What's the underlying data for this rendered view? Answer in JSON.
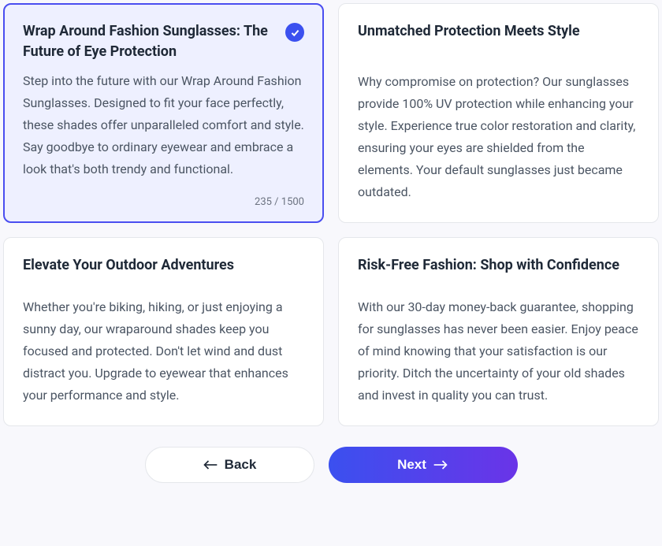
{
  "cards": {
    "c0": {
      "title": "Wrap Around Fashion Sunglasses: The Future of Eye Protection",
      "desc": "Step into the future with our Wrap Around Fashion Sunglasses. Designed to fit your face perfectly, these shades offer unparalleled comfort and style. Say goodbye to ordinary eyewear and embrace a look that's both trendy and functional.",
      "count": "235 / 1500"
    },
    "c1": {
      "title": "Unmatched Protection Meets Style",
      "desc": "Why compromise on protection? Our sunglasses provide 100% UV protection while enhancing your style. Experience true color restoration and clarity, ensuring your eyes are shielded from the elements. Your default sunglasses just became outdated."
    },
    "c2": {
      "title": "Elevate Your Outdoor Adventures",
      "desc": "Whether you're biking, hiking, or just enjoying a sunny day, our wraparound shades keep you focused and protected. Don't let wind and dust distract you. Upgrade to eyewear that enhances your performance and style."
    },
    "c3": {
      "title": "Risk-Free Fashion: Shop with Confidence",
      "desc": "With our 30-day money-back guarantee, shopping for sunglasses has never been easier. Enjoy peace of mind knowing that your satisfaction is our priority. Ditch the uncertainty of your old shades and invest in quality you can trust."
    }
  },
  "footer": {
    "back": "Back",
    "next": "Next"
  }
}
